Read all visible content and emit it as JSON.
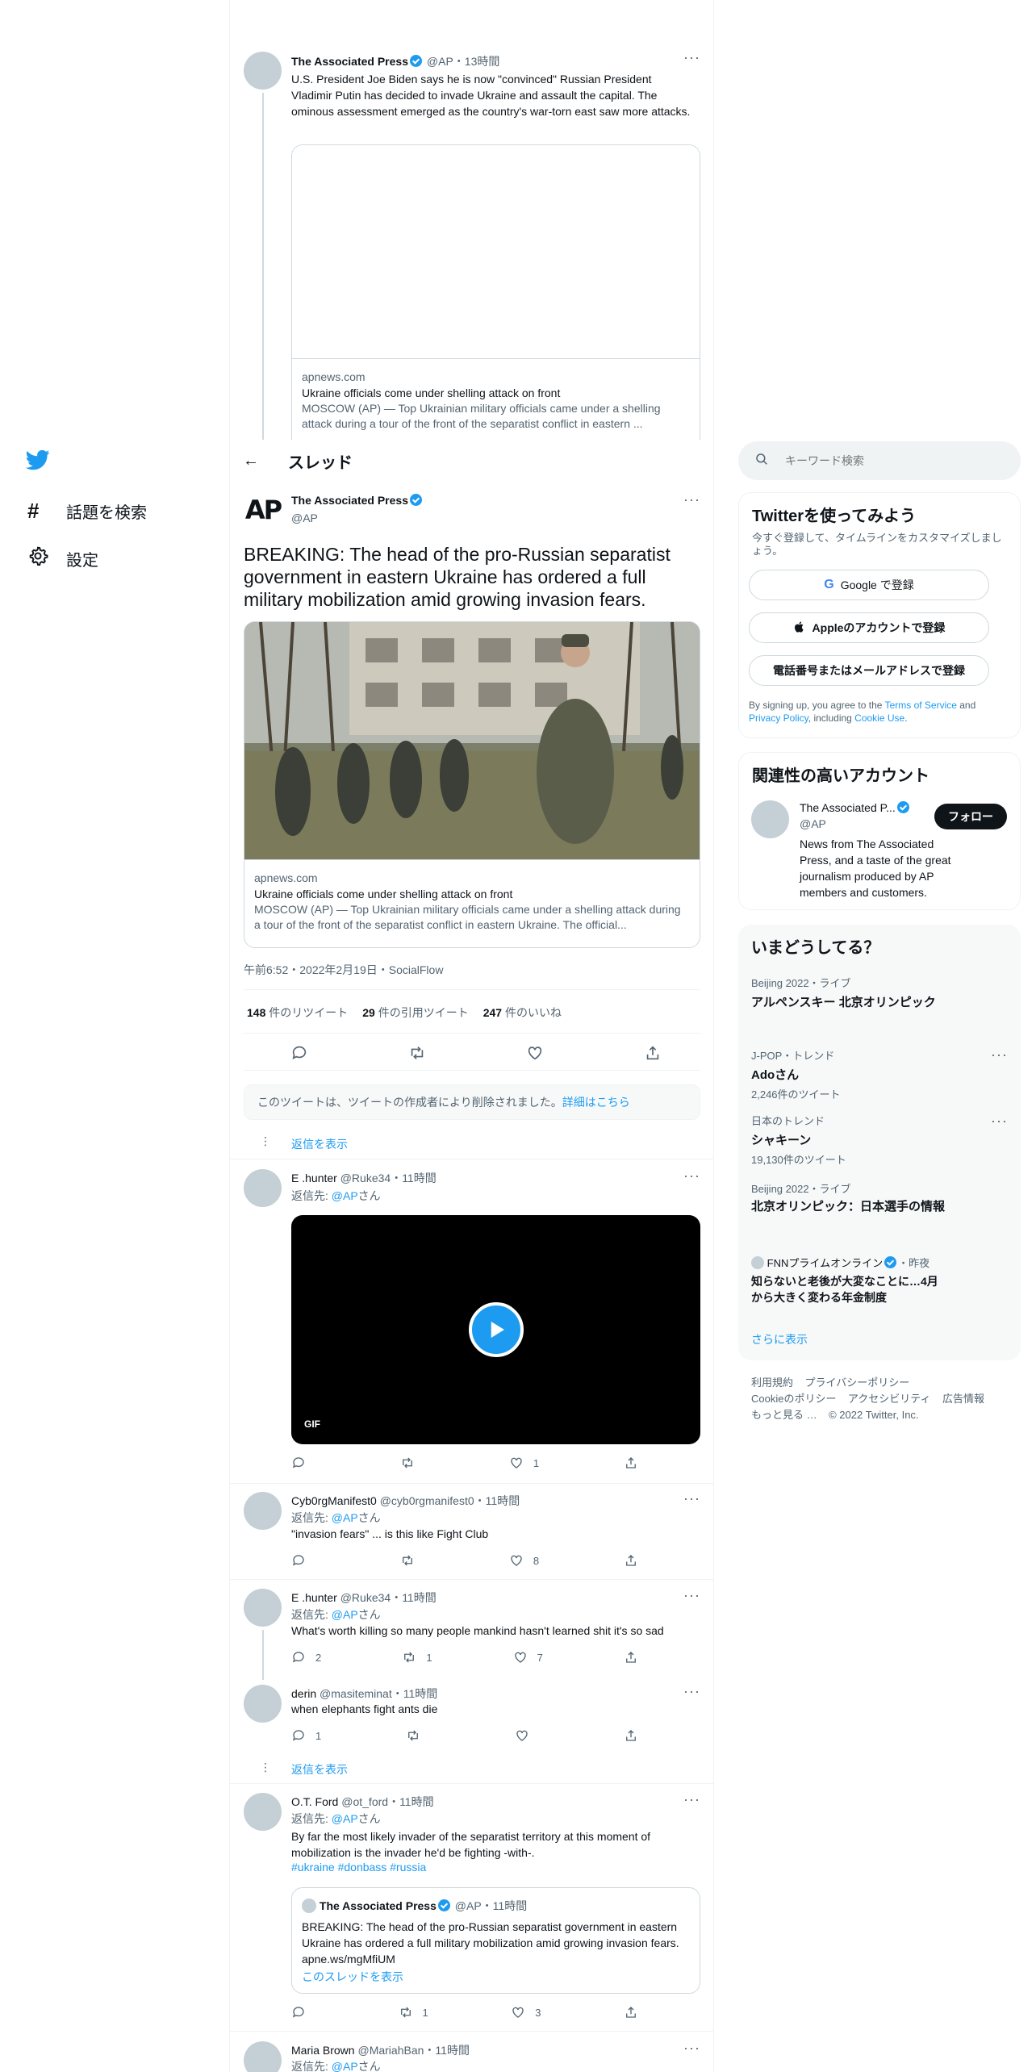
{
  "nav": {
    "home_label": "",
    "explore_label": "話題を検索",
    "settings_label": "設定"
  },
  "prev_tweet": {
    "author": "The Associated Press",
    "handle": "@AP",
    "time": "13時間",
    "text": "U.S. President Joe Biden says he is now \"convinced\" Russian President Vladimir Putin has decided to invade Ukraine and assault the capital. The ominous assessment emerged as the country's war-torn east saw more attacks.",
    "card": {
      "domain": "apnews.com",
      "title": "Ukraine officials come under shelling attack on front",
      "desc": "MOSCOW (AP) — Top Ukrainian military officials came under a shelling attack during a tour of the front of the separatist conflict in eastern ..."
    }
  },
  "header": {
    "title": "スレッド"
  },
  "main_tweet": {
    "author": "The Associated Press",
    "handle": "@AP",
    "logo": "AP",
    "text": "BREAKING: The head of the pro-Russian separatist government in eastern Ukraine has ordered a full military mobilization amid growing invasion fears.",
    "card": {
      "domain": "apnews.com",
      "title": "Ukraine officials come under shelling attack on front",
      "desc": "MOSCOW (AP) — Top Ukrainian military officials came under a shelling attack during a tour of the front of the separatist conflict in eastern Ukraine. The official..."
    },
    "meta": "午前6:52・2022年2月19日・SocialFlow",
    "stats": {
      "retweets": "148",
      "retweets_label": "件のリツイート",
      "quotes": "29",
      "quotes_label": "件の引用ツイート",
      "likes": "247",
      "likes_label": "件のいいね"
    }
  },
  "deleted_notice": {
    "text": "このツイートは、ツイートの作成者により削除されました。",
    "link": "詳細はこちら"
  },
  "show_replies": "返信を表示",
  "replies": [
    {
      "name": "E .hunter",
      "handle": "@Ruke34",
      "time": "11時間",
      "reply_to": "返信先: ",
      "reply_handle": "@AP",
      "reply_suffix": "さん",
      "gif_label": "GIF",
      "counts": {
        "reply": "",
        "retweet": "",
        "like": "1"
      }
    },
    {
      "name": "Cyb0rgManifest0",
      "handle": "@cyb0rgmanifest0",
      "time": "11時間",
      "reply_to": "返信先: ",
      "reply_handle": "@AP",
      "reply_suffix": "さん",
      "text": "\"invasion fears\" ... is this like Fight Club",
      "counts": {
        "reply": "",
        "retweet": "",
        "like": "8"
      }
    },
    {
      "name": "E .hunter",
      "handle": "@Ruke34",
      "time": "11時間",
      "reply_to": "返信先: ",
      "reply_handle": "@AP",
      "reply_suffix": "さん",
      "text": "What's worth killing so many people mankind hasn't learned shit it's so sad",
      "counts": {
        "reply": "2",
        "retweet": "1",
        "like": "7"
      }
    },
    {
      "name": "derin",
      "handle": "@masiteminat",
      "time": "11時間",
      "text": "when elephants fight ants die",
      "counts": {
        "reply": "1",
        "retweet": "",
        "like": ""
      }
    },
    {
      "name": "O.T. Ford",
      "handle": "@ot_ford",
      "time": "11時間",
      "reply_to": "返信先: ",
      "reply_handle": "@AP",
      "reply_suffix": "さん",
      "text": "By far the most likely invader of the separatist territory at this moment of mobilization is the invader he'd be fighting -with-.",
      "hashtags": "#ukraine #donbass #russia",
      "quote": {
        "author": "The Associated Press",
        "handle": "@AP",
        "time": "11時間",
        "text": "BREAKING: The head of the pro-Russian separatist government in eastern Ukraine has ordered a full military mobilization amid growing invasion fears. apne.ws/mgMfiUM",
        "link": "このスレッドを表示"
      },
      "counts": {
        "reply": "",
        "retweet": "1",
        "like": "3"
      }
    },
    {
      "name": "Maria Brown",
      "handle": "@MariahBan",
      "time": "11時間",
      "reply_to": "返信先: ",
      "reply_handle": "@AP",
      "reply_suffix": "さん"
    }
  ],
  "search": {
    "placeholder": "キーワード検索"
  },
  "signup": {
    "title": "Twitterを使ってみよう",
    "subtitle": "今すぐ登録して、タイムラインをカスタマイズしましょう。",
    "google": "Google で登録",
    "apple": "Appleのアカウントで登録",
    "phone": "電話番号またはメールアドレスで登録",
    "legal_1": "By signing up, you agree to the ",
    "terms": "Terms of Service",
    "legal_2": " and ",
    "privacy": "Privacy Policy",
    "legal_3": ", including ",
    "cookie": "Cookie Use",
    "legal_4": "."
  },
  "relevant": {
    "title": "関連性の高いアカウント",
    "name": "The Associated P...",
    "handle": "@AP",
    "follow": "フォロー",
    "bio": "News from The Associated Press, and a taste of the great journalism produced by AP members and customers."
  },
  "trends": {
    "title": "いまどうしてる？",
    "items": [
      {
        "meta": "Beijing 2022・ライブ",
        "name": "アルペンスキー 北京オリンピック"
      },
      {
        "meta": "J-POP・トレンド",
        "name": "Adoさん",
        "count": "2,246件のツイート"
      },
      {
        "meta": "日本のトレンド",
        "name": "シャキーン",
        "count": "19,130件のツイート"
      },
      {
        "meta": "Beijing 2022・ライブ",
        "name": "北京オリンピック：日本選手の情報"
      },
      {
        "meta": "FNNプライムオンライン",
        "meta_time": "・昨夜",
        "name": "知らないと老後が大変なことに…4月から大きく変わる年金制度"
      }
    ],
    "more": "さらに表示"
  },
  "footer": {
    "l1": "利用規約",
    "l2": "プライバシーポリシー",
    "l3": "Cookieのポリシー",
    "l4": "アクセシビリティ",
    "l5": "広告情報",
    "l6": "もっと見る …",
    "l7": "© 2022 Twitter, Inc."
  }
}
